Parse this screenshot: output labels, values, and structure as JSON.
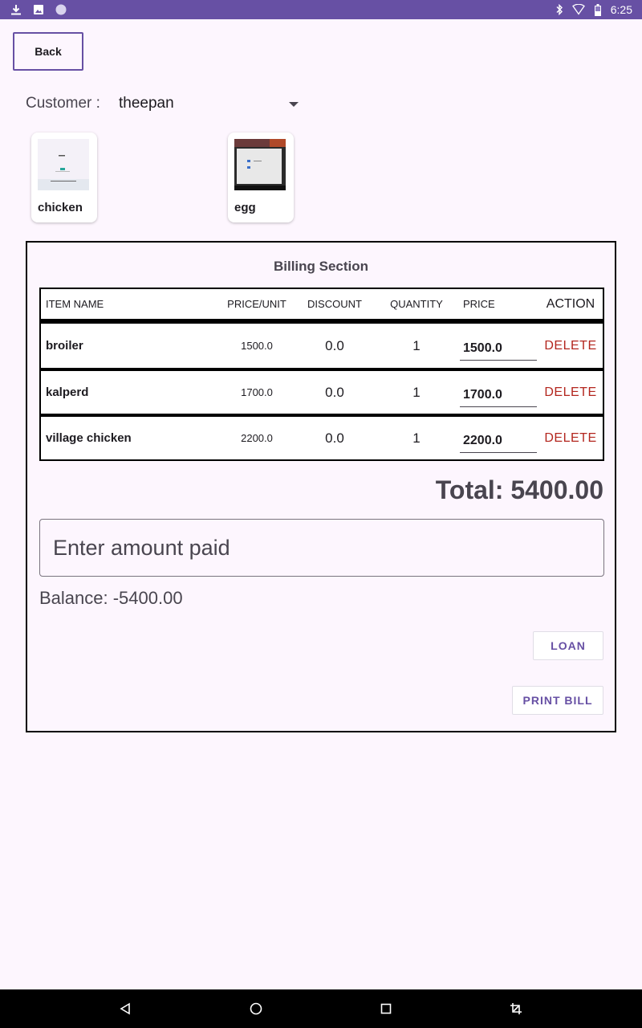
{
  "status_bar": {
    "time": "6:25",
    "icons": [
      "download-icon",
      "image-icon",
      "circle-icon",
      "bluetooth-icon",
      "wifi-icon",
      "battery-icon"
    ]
  },
  "back_label": "Back",
  "customer": {
    "label": "Customer :",
    "value": "theepan"
  },
  "products": [
    {
      "name": "chicken"
    },
    {
      "name": "egg"
    }
  ],
  "billing": {
    "title": "Billing Section",
    "columns": [
      "ITEM NAME",
      "PRICE/UNIT",
      "DISCOUNT",
      "QUANTITY",
      "PRICE",
      "ACTION"
    ],
    "rows": [
      {
        "item": "broiler",
        "price_unit": "1500.0",
        "discount": "0.0",
        "quantity": "1",
        "price": "1500.0",
        "action": "DELETE"
      },
      {
        "item": "kalperd",
        "price_unit": "1700.0",
        "discount": "0.0",
        "quantity": "1",
        "price": "1700.0",
        "action": "DELETE"
      },
      {
        "item": "village chicken",
        "price_unit": "2200.0",
        "discount": "0.0",
        "quantity": "1",
        "price": "2200.0",
        "action": "DELETE"
      }
    ],
    "total": "Total: 5400.00",
    "amount_placeholder": "Enter amount paid",
    "balance": "Balance: -5400.00",
    "loan_label": "LOAN",
    "print_label": "PRINT BILL"
  },
  "colors": {
    "accent": "#6750a4",
    "delete": "#b3261e",
    "background": "#fdf6fe"
  },
  "nav_icons": [
    "back-icon",
    "home-icon",
    "recents-icon",
    "screenshot-icon"
  ]
}
